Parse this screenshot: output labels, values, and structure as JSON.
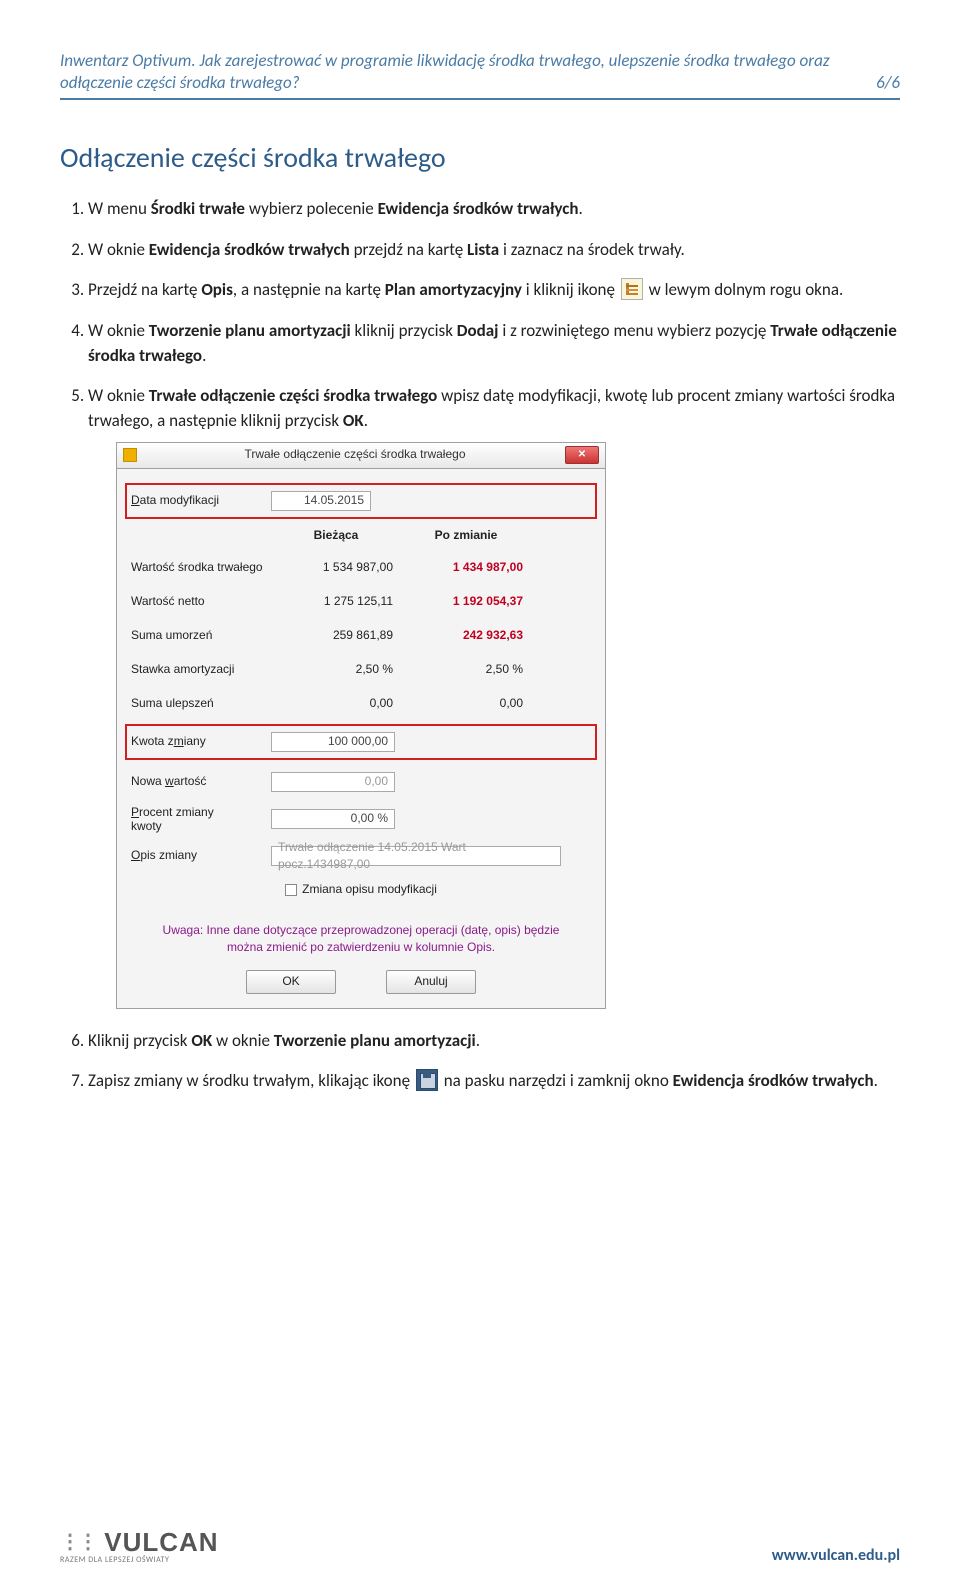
{
  "header": {
    "title": "Inwentarz Optivum. Jak zarejestrować w programie likwidację środka trwałego, ulepszenie środka trwałego oraz odłączenie części środka trwałego?",
    "page": "6/6"
  },
  "section_title": "Odłączenie części środka trwałego",
  "steps": {
    "s1": {
      "pre": "W menu ",
      "b1": "Środki trwałe",
      "mid": " wybierz polecenie ",
      "b2": "Ewidencja środków trwałych",
      "post": "."
    },
    "s2": {
      "pre": "W oknie ",
      "b1": "Ewidencja środków trwałych",
      "mid": " przejdź na kartę ",
      "b2": "Lista",
      "post": " i zaznacz na środek trwały."
    },
    "s3": {
      "pre": "Przejdź na kartę ",
      "b1": "Opis",
      "mid": ", a następnie na kartę ",
      "b2": "Plan amortyzacyjny",
      "mid2": " i kliknij ikonę ",
      "post": " w lewym dolnym rogu okna."
    },
    "s4": {
      "pre": "W oknie ",
      "b1": "Tworzenie planu amortyzacji",
      "mid": " kliknij przycisk ",
      "b2": "Dodaj",
      "mid2": " i z rozwiniętego menu wybierz pozycję ",
      "b3": "Trwałe odłączenie środka trwałego",
      "post": "."
    },
    "s5": {
      "pre": "W oknie ",
      "b1": "Trwałe odłączenie części środka trwałego",
      "mid": " wpisz datę modyfikacji, kwotę lub procent zmiany wartości środka trwałego, a następnie kliknij przycisk ",
      "b2": "OK",
      "post": "."
    },
    "s6": {
      "pre": "Kliknij przycisk ",
      "b1": "OK",
      "mid": " w oknie ",
      "b2": "Tworzenie planu amortyzacji",
      "post": "."
    },
    "s7": {
      "pre": "Zapisz zmiany w środku trwałym, klikając ikonę ",
      "mid": " na pasku narzędzi i zamknij okno ",
      "b1": "Ewidencja środków trwałych",
      "post": "."
    }
  },
  "dialog": {
    "title": "Trwałe odłączenie części środka trwałego",
    "date_label": "Data modyfikacji",
    "date_value": "14.05.2015",
    "cols": {
      "c1": "Bieżąca",
      "c2": "Po zmianie"
    },
    "rows": [
      {
        "label": "Wartość środka trwałego",
        "v1": "1 534 987,00",
        "v2": "1 434 987,00",
        "red": true
      },
      {
        "label": "Wartość netto",
        "v1": "1 275 125,11",
        "v2": "1 192 054,37",
        "red": true
      },
      {
        "label": "Suma umorzeń",
        "v1": "259 861,89",
        "v2": "242 932,63",
        "red": true
      },
      {
        "label": "Stawka amortyzacji",
        "v1": "2,50 %",
        "v2": "2,50 %",
        "red": false
      },
      {
        "label": "Suma ulepszeń",
        "v1": "0,00",
        "v2": "0,00",
        "red": false
      }
    ],
    "kwota_label": "Kwota zmiany",
    "kwota_value": "100 000,00",
    "nowa_label": "Nowa wartość",
    "nowa_value": "0,00",
    "procent_label": "Procent zmiany kwoty",
    "procent_value": "0,00 %",
    "opis_label": "Opis zmiany",
    "opis_value": "Trwałe odłączenie 14.05.2015 Wart pocz.1434987,00",
    "checkbox": "Zmiana opisu modyfikacji",
    "note": "Uwaga: Inne dane dotyczące przeprowadzonej operacji (datę, opis) będzie można zmienić po zatwierdzeniu w kolumnie Opis.",
    "ok": "OK",
    "cancel": "Anuluj"
  },
  "footer": {
    "logo": "VULCAN",
    "logo_sub": "RAZEM DLA LEPSZEJ OŚWIATY",
    "url": "www.vulcan.edu.pl"
  }
}
